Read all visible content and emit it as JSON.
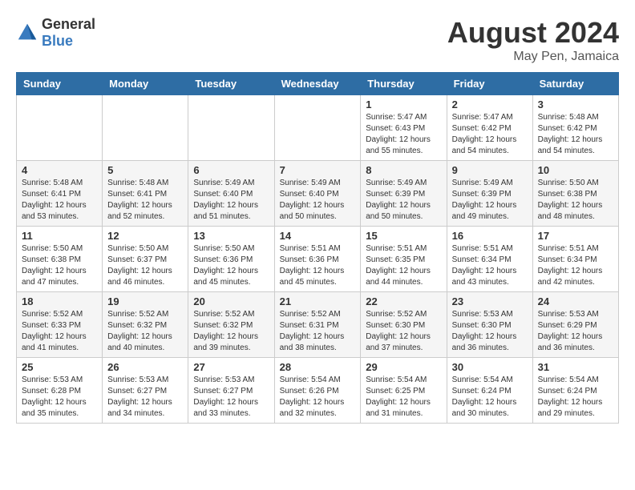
{
  "logo": {
    "general": "General",
    "blue": "Blue"
  },
  "title": {
    "month_year": "August 2024",
    "location": "May Pen, Jamaica"
  },
  "headers": [
    "Sunday",
    "Monday",
    "Tuesday",
    "Wednesday",
    "Thursday",
    "Friday",
    "Saturday"
  ],
  "weeks": [
    [
      {
        "day": "",
        "info": ""
      },
      {
        "day": "",
        "info": ""
      },
      {
        "day": "",
        "info": ""
      },
      {
        "day": "",
        "info": ""
      },
      {
        "day": "1",
        "info": "Sunrise: 5:47 AM\nSunset: 6:43 PM\nDaylight: 12 hours\nand 55 minutes."
      },
      {
        "day": "2",
        "info": "Sunrise: 5:47 AM\nSunset: 6:42 PM\nDaylight: 12 hours\nand 54 minutes."
      },
      {
        "day": "3",
        "info": "Sunrise: 5:48 AM\nSunset: 6:42 PM\nDaylight: 12 hours\nand 54 minutes."
      }
    ],
    [
      {
        "day": "4",
        "info": "Sunrise: 5:48 AM\nSunset: 6:41 PM\nDaylight: 12 hours\nand 53 minutes."
      },
      {
        "day": "5",
        "info": "Sunrise: 5:48 AM\nSunset: 6:41 PM\nDaylight: 12 hours\nand 52 minutes."
      },
      {
        "day": "6",
        "info": "Sunrise: 5:49 AM\nSunset: 6:40 PM\nDaylight: 12 hours\nand 51 minutes."
      },
      {
        "day": "7",
        "info": "Sunrise: 5:49 AM\nSunset: 6:40 PM\nDaylight: 12 hours\nand 50 minutes."
      },
      {
        "day": "8",
        "info": "Sunrise: 5:49 AM\nSunset: 6:39 PM\nDaylight: 12 hours\nand 50 minutes."
      },
      {
        "day": "9",
        "info": "Sunrise: 5:49 AM\nSunset: 6:39 PM\nDaylight: 12 hours\nand 49 minutes."
      },
      {
        "day": "10",
        "info": "Sunrise: 5:50 AM\nSunset: 6:38 PM\nDaylight: 12 hours\nand 48 minutes."
      }
    ],
    [
      {
        "day": "11",
        "info": "Sunrise: 5:50 AM\nSunset: 6:38 PM\nDaylight: 12 hours\nand 47 minutes."
      },
      {
        "day": "12",
        "info": "Sunrise: 5:50 AM\nSunset: 6:37 PM\nDaylight: 12 hours\nand 46 minutes."
      },
      {
        "day": "13",
        "info": "Sunrise: 5:50 AM\nSunset: 6:36 PM\nDaylight: 12 hours\nand 45 minutes."
      },
      {
        "day": "14",
        "info": "Sunrise: 5:51 AM\nSunset: 6:36 PM\nDaylight: 12 hours\nand 45 minutes."
      },
      {
        "day": "15",
        "info": "Sunrise: 5:51 AM\nSunset: 6:35 PM\nDaylight: 12 hours\nand 44 minutes."
      },
      {
        "day": "16",
        "info": "Sunrise: 5:51 AM\nSunset: 6:34 PM\nDaylight: 12 hours\nand 43 minutes."
      },
      {
        "day": "17",
        "info": "Sunrise: 5:51 AM\nSunset: 6:34 PM\nDaylight: 12 hours\nand 42 minutes."
      }
    ],
    [
      {
        "day": "18",
        "info": "Sunrise: 5:52 AM\nSunset: 6:33 PM\nDaylight: 12 hours\nand 41 minutes."
      },
      {
        "day": "19",
        "info": "Sunrise: 5:52 AM\nSunset: 6:32 PM\nDaylight: 12 hours\nand 40 minutes."
      },
      {
        "day": "20",
        "info": "Sunrise: 5:52 AM\nSunset: 6:32 PM\nDaylight: 12 hours\nand 39 minutes."
      },
      {
        "day": "21",
        "info": "Sunrise: 5:52 AM\nSunset: 6:31 PM\nDaylight: 12 hours\nand 38 minutes."
      },
      {
        "day": "22",
        "info": "Sunrise: 5:52 AM\nSunset: 6:30 PM\nDaylight: 12 hours\nand 37 minutes."
      },
      {
        "day": "23",
        "info": "Sunrise: 5:53 AM\nSunset: 6:30 PM\nDaylight: 12 hours\nand 36 minutes."
      },
      {
        "day": "24",
        "info": "Sunrise: 5:53 AM\nSunset: 6:29 PM\nDaylight: 12 hours\nand 36 minutes."
      }
    ],
    [
      {
        "day": "25",
        "info": "Sunrise: 5:53 AM\nSunset: 6:28 PM\nDaylight: 12 hours\nand 35 minutes."
      },
      {
        "day": "26",
        "info": "Sunrise: 5:53 AM\nSunset: 6:27 PM\nDaylight: 12 hours\nand 34 minutes."
      },
      {
        "day": "27",
        "info": "Sunrise: 5:53 AM\nSunset: 6:27 PM\nDaylight: 12 hours\nand 33 minutes."
      },
      {
        "day": "28",
        "info": "Sunrise: 5:54 AM\nSunset: 6:26 PM\nDaylight: 12 hours\nand 32 minutes."
      },
      {
        "day": "29",
        "info": "Sunrise: 5:54 AM\nSunset: 6:25 PM\nDaylight: 12 hours\nand 31 minutes."
      },
      {
        "day": "30",
        "info": "Sunrise: 5:54 AM\nSunset: 6:24 PM\nDaylight: 12 hours\nand 30 minutes."
      },
      {
        "day": "31",
        "info": "Sunrise: 5:54 AM\nSunset: 6:24 PM\nDaylight: 12 hours\nand 29 minutes."
      }
    ]
  ]
}
